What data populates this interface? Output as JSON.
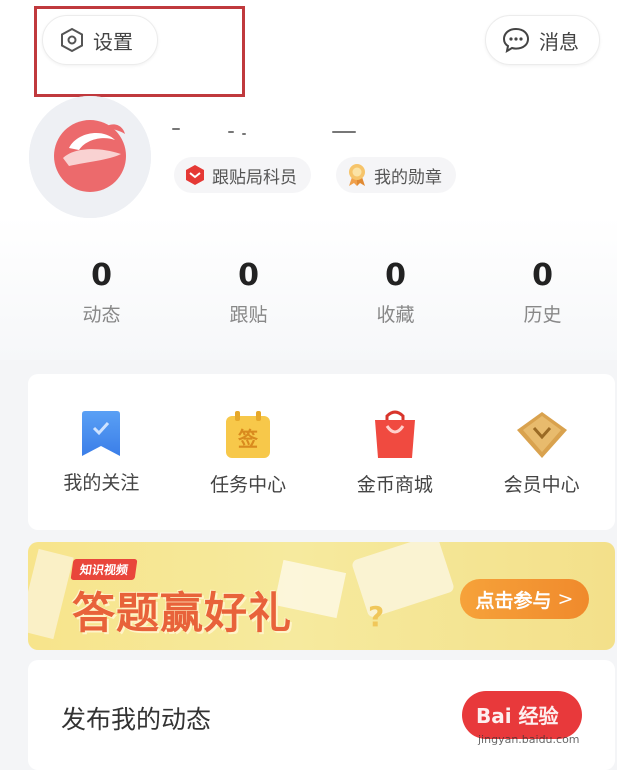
{
  "header": {
    "settings_label": "设置",
    "messages_label": "消息"
  },
  "profile": {
    "tags": [
      {
        "label": "跟贴局科员",
        "icon": "red-shield-badge-icon"
      },
      {
        "label": "我的勋章",
        "icon": "medal-icon"
      }
    ]
  },
  "stats": [
    {
      "value": "0",
      "label": "动态"
    },
    {
      "value": "0",
      "label": "跟贴"
    },
    {
      "value": "0",
      "label": "收藏"
    },
    {
      "value": "0",
      "label": "历史"
    }
  ],
  "grid": [
    {
      "label": "我的关注",
      "icon": "bookmark-icon"
    },
    {
      "label": "任务中心",
      "icon": "sign-in-calendar-icon",
      "icon_text": "签"
    },
    {
      "label": "金币商城",
      "icon": "shopping-bag-icon"
    },
    {
      "label": "会员中心",
      "icon": "diamond-icon"
    }
  ],
  "banner": {
    "badge": "知识视频",
    "title": "答题赢好礼",
    "button": "点击参与",
    "button_arrow": ">"
  },
  "post": {
    "title": "发布我的动态"
  },
  "watermark": {
    "brand": "Bai 经验",
    "url": "jingyan.baidu.com"
  },
  "colors": {
    "accent_red": "#e8393b",
    "highlight_box": "#c0393d",
    "banner_orange": "#f08a2c"
  }
}
